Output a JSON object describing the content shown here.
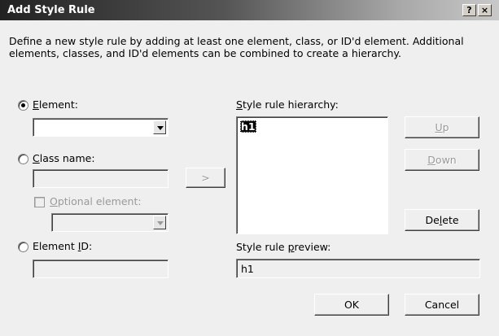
{
  "window": {
    "title": "Add Style Rule",
    "help_button": "?",
    "close_button": "×"
  },
  "description": "Define a new style rule by adding at least one element, class, or ID'd element.  Additional elements, classes, and ID'd elements can be combined to create a hierarchy.",
  "element": {
    "label_pre": "",
    "label_key": "E",
    "label_post": "lement:",
    "selected": true,
    "value": ""
  },
  "class_name": {
    "label_pre": "",
    "label_key": "C",
    "label_post": "lass name:",
    "selected": false,
    "value": ""
  },
  "optional_element": {
    "label_pre": "",
    "label_key": "O",
    "label_post": "ptional element:",
    "checked": false,
    "value": ""
  },
  "element_id": {
    "label_pre": "Element ",
    "label_key": "I",
    "label_post": "D:",
    "selected": false,
    "value": ""
  },
  "add_button": ">",
  "hierarchy": {
    "label_pre": "",
    "label_key": "S",
    "label_post": "tyle rule hierarchy:",
    "items": [
      "h1"
    ]
  },
  "preview": {
    "label_pre": "Style rule ",
    "label_key": "p",
    "label_post": "review:",
    "value": "h1"
  },
  "buttons": {
    "up": {
      "pre": "",
      "key": "U",
      "post": "p"
    },
    "down": {
      "pre": "",
      "key": "D",
      "post": "own"
    },
    "delete": {
      "pre": "De",
      "key": "l",
      "post": "ete"
    },
    "ok": "OK",
    "cancel": "Cancel"
  },
  "colors": {
    "dialog_bg": "#efefef",
    "selection_bg": "#000000",
    "disabled_text": "#9a9a9a"
  }
}
